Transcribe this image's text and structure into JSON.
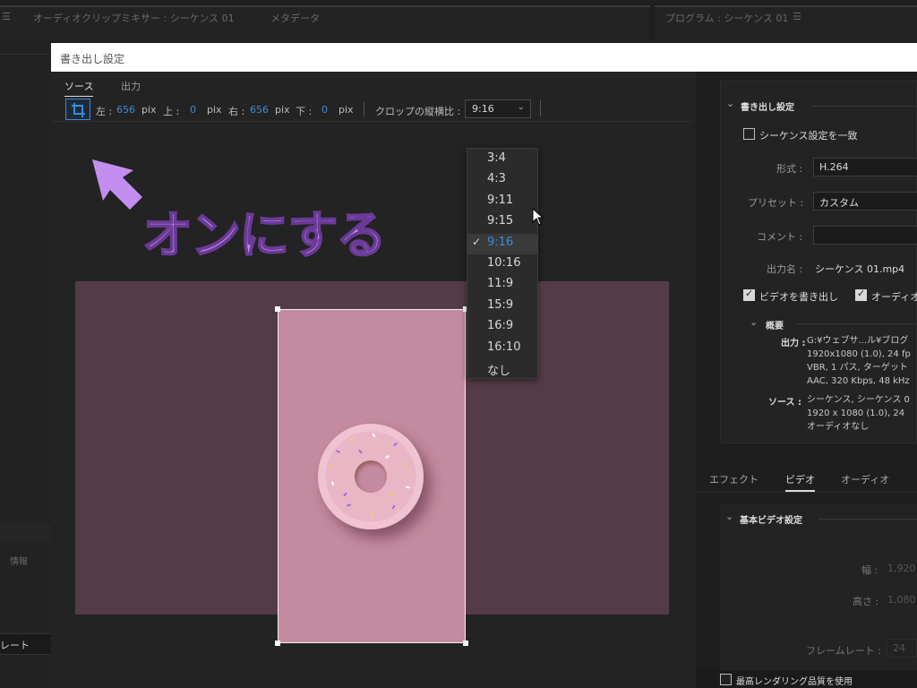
{
  "app": {
    "panel_audio_mixer": "オーディオクリップミキサー : シーケンス 01",
    "panel_metadata": "メタデータ",
    "panel_program": "プログラム : シーケンス 01",
    "left_labels": {
      "info": "情報",
      "rate": "レート"
    }
  },
  "dialog": {
    "title": "書き出し設定",
    "tabs": [
      "ソース",
      "出力"
    ],
    "crop": {
      "left_label": "左 :",
      "left_value": "656",
      "top_label": "上 :",
      "top_value": "0",
      "right_label": "右 :",
      "right_value": "656",
      "bottom_label": "下 :",
      "bottom_value": "0",
      "unit": "pix",
      "ratio_label": "クロップの縦横比 :",
      "ratio_value": "9:16"
    },
    "ratio_options": [
      "3:4",
      "4:3",
      "9:11",
      "9:15",
      "9:16",
      "10:16",
      "11:9",
      "15:9",
      "16:9",
      "16:10",
      "なし"
    ],
    "ratio_selected": "9:16",
    "annotation": "オンにする",
    "annotation_color": "#c48ef0"
  },
  "export_settings": {
    "section_title": "書き出し設定",
    "match_sequence": "シーケンス設定を一致",
    "format_label": "形式 :",
    "format_value": "H.264",
    "preset_label": "プリセット :",
    "preset_value": "カスタム",
    "comment_label": "コメント :",
    "output_name_label": "出力名 :",
    "output_name_value": "シーケンス 01.mp4",
    "export_video": "ビデオを書き出し",
    "export_audio": "オーディオ",
    "summary_title": "概要",
    "output_label": "出力 :",
    "output_lines": [
      "G:¥ウェブサ...ル¥ブログ",
      "1920x1080 (1.0), 24 fp",
      "VBR, 1 パス, ターゲット",
      "AAC, 320 Kbps, 48 kHz"
    ],
    "source_label": "ソース :",
    "source_lines": [
      "シーケンス, シーケンス 0",
      "1920 x 1080 (1.0), 24",
      "オーディオなし"
    ],
    "tabs": [
      "エフェクト",
      "ビデオ",
      "オーディオ"
    ],
    "basic_video_title": "基本ビデオ設定",
    "width_label": "幅 :",
    "width_value": "1,920",
    "height_label": "高さ :",
    "height_value": "1,080",
    "framerate_label": "フレームレート :",
    "framerate_value": "24",
    "max_render_quality": "最高レンダリング品質を使用"
  },
  "colors": {
    "accent": "#3b8cdb",
    "crop_pink": "#c48a9f",
    "backdrop": "#533c47"
  }
}
